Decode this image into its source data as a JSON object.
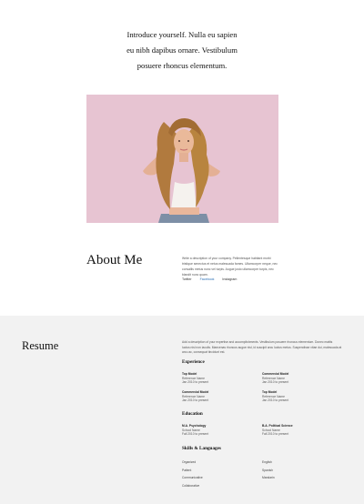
{
  "intro": {
    "line1": "Introduce yourself. Nulla eu sapien",
    "line2": "eu nibh dapibus ornare. Vestibulum",
    "line3": "posuere rhoncus elementum."
  },
  "about": {
    "title": "About Me",
    "body": [
      "Write a description of your company. Pellentesque habitant morbi",
      "tristique senectus et netus malesuada fames. Ullamcorper neque, nec",
      "convallis metus nunc vel turpis. Augue justo ullamcorper turpis, nec",
      "blandit nunc quam."
    ],
    "links": [
      "Twitter",
      "Facebook",
      "Instagram"
    ]
  },
  "resume": {
    "title": "Resume",
    "description": [
      "Add a description of your expertise and accomplishments. Vestibulum posuere rhoncus elementum. Donec mattis",
      "luctus nisl non iaculis. Maecenas rhoncus augue nisl, id suscipit arcu luctus metus. Suspendisse vitae dui, malesuada at",
      "arcu ac, consequat tincidunt est."
    ],
    "experience": {
      "heading": "Experience",
      "items": [
        {
          "title": "Top Model",
          "place": "Reference Name",
          "dates": "Jan 2010 to present"
        },
        {
          "title": "Commercial Model",
          "place": "Reference Name",
          "dates": "Jan 2010 to present"
        },
        {
          "title": "Commercial Model",
          "place": "Reference Name",
          "dates": "Jan 2010 to present"
        },
        {
          "title": "Top Model",
          "place": "Reference Name",
          "dates": "Jan 2010 to present"
        }
      ]
    },
    "education": {
      "heading": "Education",
      "items": [
        {
          "title": "M.A. Psychology",
          "place": "School Name",
          "dates": "Fall 2010 to present"
        },
        {
          "title": "B.A. Political Science",
          "place": "School Name",
          "dates": "Fall 2010 to present"
        }
      ]
    },
    "skills": {
      "heading": "Skills & Languages",
      "items": [
        "Organized",
        "English",
        "Patient",
        "Spanish",
        "Communicative",
        "Mandarin",
        "Collaborative"
      ]
    }
  }
}
